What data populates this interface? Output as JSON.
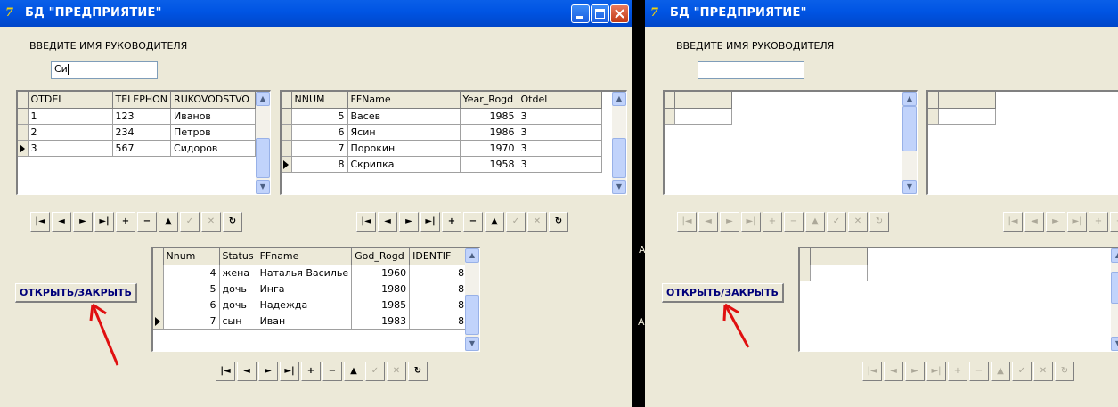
{
  "window_title": "БД \"ПРЕДПРИЯТИЕ\"",
  "app_icon_glyph": "7",
  "prompt_label": "ВВЕДИТЕ ИМЯ РУКОВОДИТЕЛЯ",
  "search_value": "Си",
  "open_close_label": "ОТКРЫТЬ/ЗАКРЫТЬ",
  "colors": {
    "titlebar": "#0054E3",
    "window_bg": "#ECE9D8",
    "button_text": "#00007A",
    "arrow": "#E01010"
  },
  "departments": {
    "columns": [
      "OTDEL",
      "TELEPHON",
      "RUKOVODSTVO"
    ],
    "rows": [
      [
        "1",
        "123",
        "Иванов"
      ],
      [
        "2",
        "234",
        "Петров"
      ],
      [
        "3",
        "567",
        "Сидоров"
      ]
    ]
  },
  "employees": {
    "columns": [
      "NNUM",
      "FFName",
      "Year_Rogd",
      "Otdel"
    ],
    "rows": [
      [
        "5",
        "Васев",
        "1985",
        "3"
      ],
      [
        "6",
        "Ясин",
        "1986",
        "3"
      ],
      [
        "7",
        "Порокин",
        "1970",
        "3"
      ],
      [
        "8",
        "Скрипка",
        "1958",
        "3"
      ]
    ]
  },
  "family": {
    "columns": [
      "Nnum",
      "Status",
      "FFname",
      "God_Rogd",
      "IDENTIF"
    ],
    "rows": [
      [
        "4",
        "жена",
        "Наталья Василье",
        "1960",
        "8"
      ],
      [
        "5",
        "дочь",
        "Инга",
        "1980",
        "8"
      ],
      [
        "6",
        "дочь",
        "Надежда",
        "1985",
        "8"
      ],
      [
        "7",
        "сын",
        "Иван",
        "1983",
        "8"
      ]
    ]
  },
  "navigator_icons": [
    "first-icon",
    "prior-icon",
    "next-icon",
    "last-icon",
    "insert-icon",
    "delete-icon",
    "edit-icon",
    "post-icon",
    "cancel-icon",
    "refresh-icon"
  ],
  "navigator_glyphs": [
    "|◄",
    "◄",
    "►",
    "►|",
    "+",
    "−",
    "▲",
    "✓",
    "✕",
    "↻"
  ],
  "edge_glyphs": [
    "А",
    "А"
  ]
}
